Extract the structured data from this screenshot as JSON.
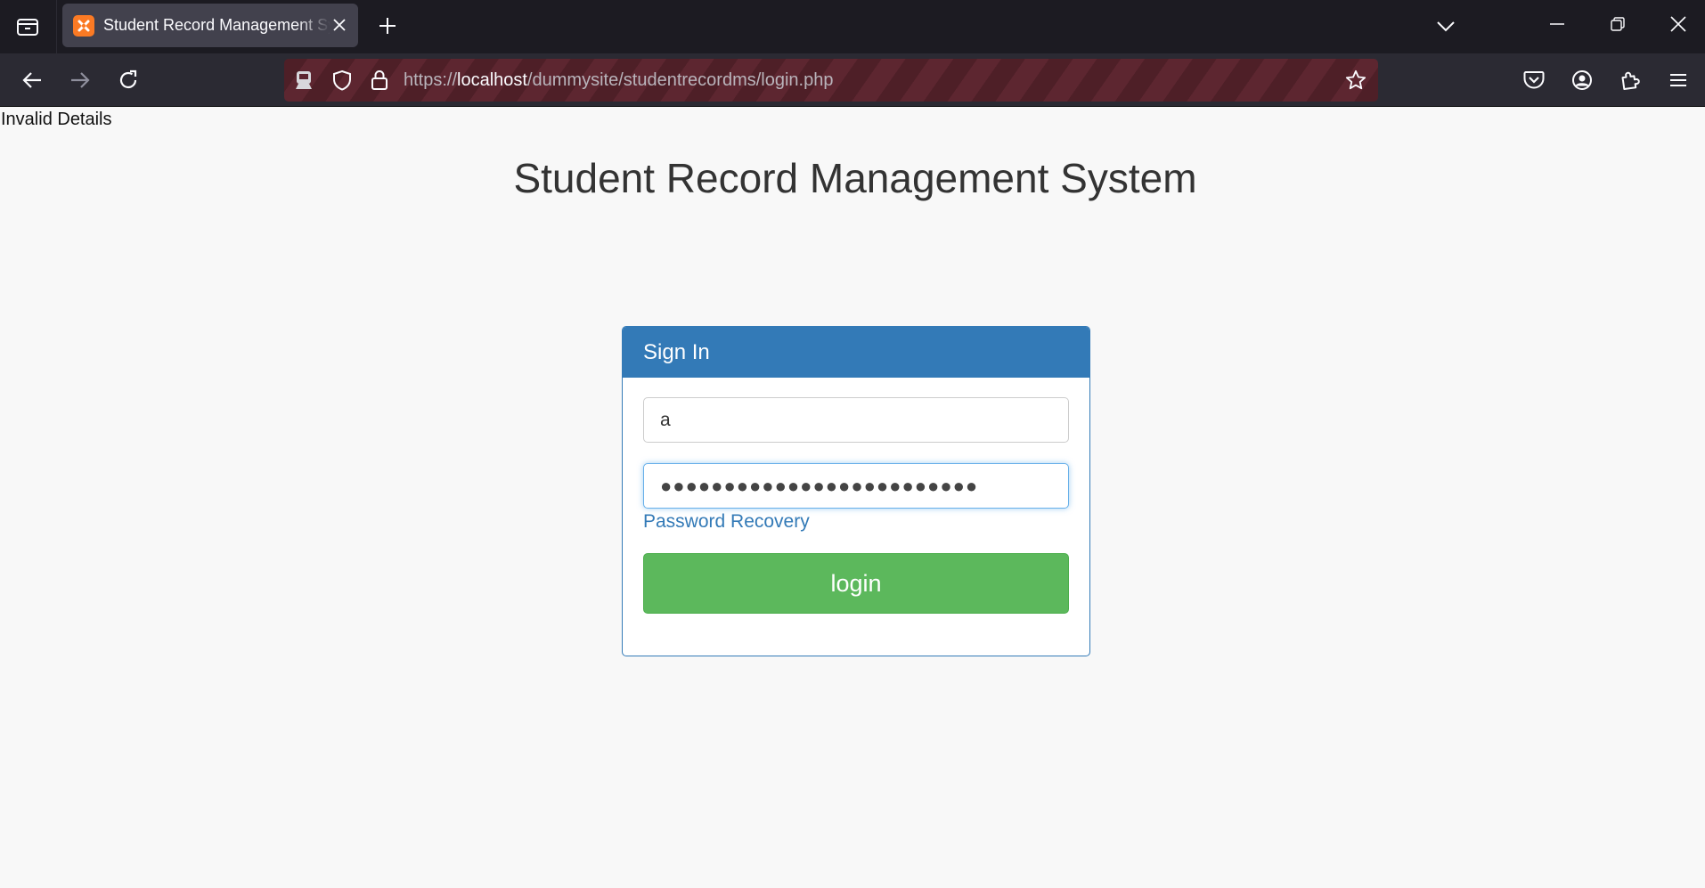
{
  "browser": {
    "tab": {
      "title": "Student Record Management System",
      "favicon": "xampp-icon"
    },
    "url": {
      "scheme": "https://",
      "host": "localhost",
      "path": "/dummysite/studentrecordms/login.php"
    },
    "accent": "#5d2630"
  },
  "page": {
    "message": "Invalid Details",
    "title": "Student Record Management System",
    "panel": {
      "heading": "Sign In",
      "username_value": "a",
      "password_masked": "●●●●●●●●●●●●●●●●●●●●●●●●●",
      "recovery_link": "Password Recovery",
      "login_label": "login"
    },
    "colors": {
      "panel_primary": "#337ab7",
      "login_button": "#5cb85c",
      "link": "#337ab7"
    }
  }
}
